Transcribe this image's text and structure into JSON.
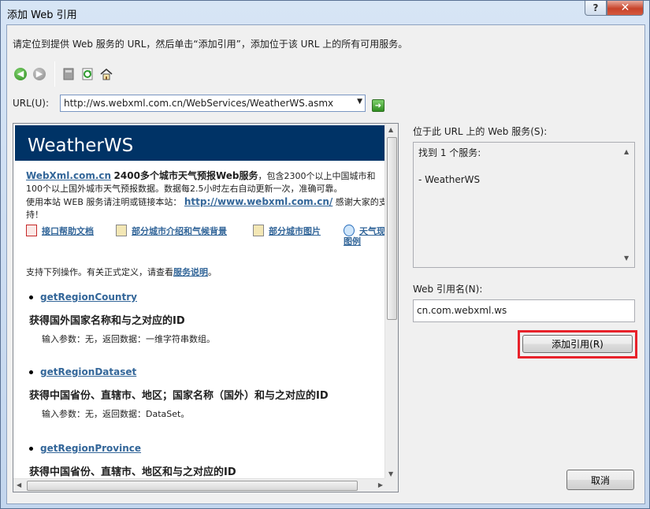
{
  "window": {
    "title": "添加 Web 引用",
    "help_button": "?",
    "close_button": "✕"
  },
  "instructions": "请定位到提供 Web 服务的 URL，然后单击“添加引用”，添加位于该 URL 上的所有可用服务。",
  "toolbar": {
    "icons": [
      "back-icon",
      "forward-icon",
      "stop-icon",
      "refresh-icon",
      "home-icon"
    ]
  },
  "url": {
    "label": "URL(U):",
    "value": "http://ws.webxml.com.cn/WebServices/WeatherWS.asmx"
  },
  "document": {
    "service_title": "WeatherWS",
    "intro_link": "WebXml.com.cn",
    "intro_bold": "2400多个城市天气预报Web服务",
    "intro_text1": "，包含2300个以上中国城市和100个以上国外城市天气预报数据。数据每2.5小时左右自动更新一次，准确可靠。",
    "intro_text2": "使用本站 WEB 服务请注明或链接本站：",
    "intro_site_link": "http://www.webxml.com.cn/",
    "intro_text3": " 感谢大家的支持！",
    "links": [
      "接口帮助文档",
      "部分城市介绍和气候背景",
      "部分城市图片",
      "天气现象和图例"
    ],
    "support_text": "支持下列操作。有关正式定义，请查看",
    "support_link": "服务说明",
    "support_end": "。",
    "operations": [
      {
        "name": "getRegionCountry",
        "desc": "获得国外国家名称和与之对应的ID",
        "params": "输入参数：无，返回数据：一维字符串数组。"
      },
      {
        "name": "getRegionDataset",
        "desc": "获得中国省份、直辖市、地区；国家名称（国外）和与之对应的ID",
        "params": "输入参数：无，返回数据：DataSet。"
      },
      {
        "name": "getRegionProvince",
        "desc": "获得中国省份、直辖市、地区和与之对应的ID",
        "params": ""
      }
    ]
  },
  "services": {
    "label": "位于此 URL 上的 Web 服务(S):",
    "found": "找到 1 个服务:",
    "item": "- WeatherWS"
  },
  "reference": {
    "label": "Web 引用名(N):",
    "value": "cn.com.webxml.ws"
  },
  "buttons": {
    "add": "添加引用(R)",
    "cancel": "取消"
  }
}
